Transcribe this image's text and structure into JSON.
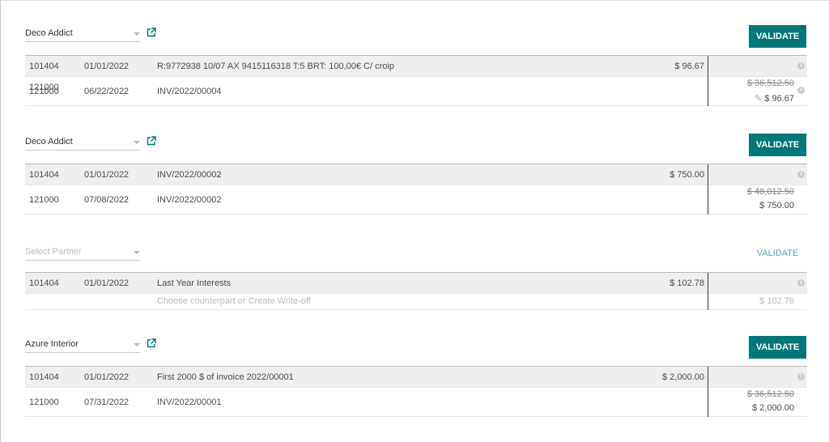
{
  "blocks": [
    {
      "partner": "Deco Addict",
      "validate": "VALIDATE",
      "validate_enabled": true,
      "line": {
        "account": "101404",
        "date": "01/01/2022",
        "label": "R:9772938 10/07 AX 9415116318 T:5 BRT: 100,00€ C/ croip",
        "amount": "$ 96.67"
      },
      "counterpart": {
        "account": "121000",
        "date": "06/22/2022",
        "label": "INV/2022/00004",
        "original": "$ 36,512.50",
        "matched": "$ 96.67",
        "editable": true
      }
    },
    {
      "partner": "Deco Addict",
      "validate": "VALIDATE",
      "validate_enabled": true,
      "line": {
        "account": "101404",
        "date": "01/01/2022",
        "label": "INV/2022/00002",
        "amount": "$ 750.00"
      },
      "counterpart": {
        "account": "121000",
        "date": "07/08/2022",
        "label": "INV/2022/00002",
        "original": "$ 48,012.50",
        "matched": "$ 750.00"
      }
    },
    {
      "partner_placeholder": "Select Partner",
      "validate": "VALIDATE",
      "validate_enabled": false,
      "line": {
        "account": "101404",
        "date": "01/01/2022",
        "label": "Last Year Interests",
        "amount": "$ 102.78"
      },
      "placeholder_row": {
        "label": "Choose counterpart or Create Write-off",
        "amount": "$ 102.78"
      }
    },
    {
      "partner": "Azure Interior",
      "validate": "VALIDATE",
      "validate_enabled": true,
      "line": {
        "account": "101404",
        "date": "01/01/2022",
        "label": "First 2000 $ of invoice 2022/00001",
        "amount": "$ 2,000.00"
      },
      "counterpart": {
        "account": "121000",
        "date": "07/31/2022",
        "label": "INV/2022/00001",
        "original": "$ 36,512.50",
        "matched": "$ 2,000.00"
      }
    }
  ],
  "colors": {
    "accent": "#00787a",
    "row_bg": "#eeeeee"
  }
}
